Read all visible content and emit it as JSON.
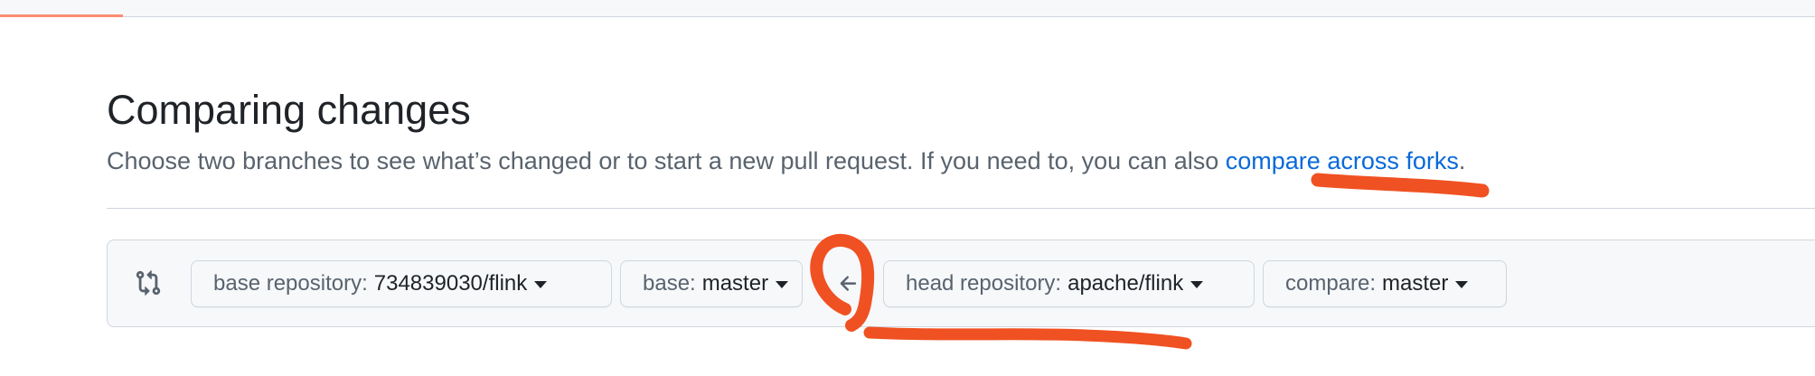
{
  "header": {
    "title": "Comparing changes",
    "subtitle_prefix": "Choose two branches to see what’s changed or to start a new pull request. If you need to, you can also ",
    "subtitle_link": "compare across forks",
    "subtitle_suffix": "."
  },
  "range": {
    "base_repo": {
      "label": "base repository:",
      "value": "734839030/flink"
    },
    "base_branch": {
      "label": "base:",
      "value": "master"
    },
    "head_repo": {
      "label": "head repository:",
      "value": "apache/flink"
    },
    "compare_branch": {
      "label": "compare:",
      "value": "master"
    }
  },
  "icons": {
    "compare": "git-compare-icon",
    "direction": "arrow-left-icon",
    "dropdown": "caret-down-icon"
  },
  "colors": {
    "link": "#0969da",
    "annotation": "#f05122",
    "tab_underline": "#fd8c73"
  }
}
